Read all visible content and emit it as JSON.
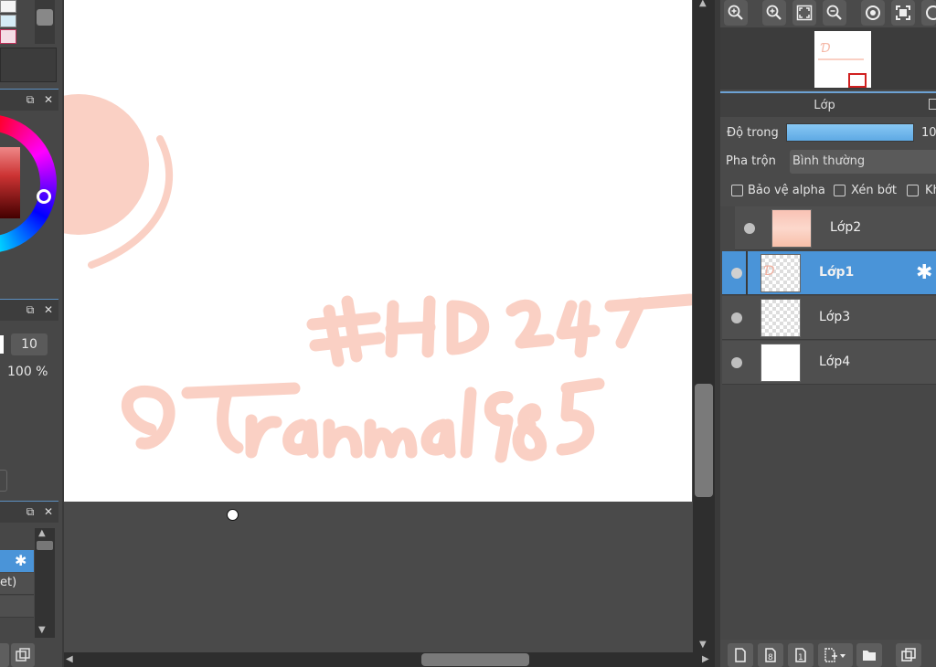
{
  "left_panel": {
    "brush_size_value": "10",
    "opacity_value": "100 %",
    "list_item_partial": "et)"
  },
  "layers_panel": {
    "tab_label": "Lớp",
    "opacity_label": "Độ trong",
    "opacity_value": "10",
    "blend_label": "Pha trộn",
    "blend_value": "Bình thường",
    "protect_alpha_label": "Bảo vệ alpha",
    "clipping_label": "Xén bớt",
    "lock_label_partial": "Kh",
    "layers": [
      {
        "name": "Lớp2",
        "selected": false
      },
      {
        "name": "Lớp1",
        "selected": true
      },
      {
        "name": "Lớp3",
        "selected": false
      },
      {
        "name": "Lớp4",
        "selected": false
      }
    ]
  },
  "colors": {
    "accent": "#4a94d8",
    "artwork_stroke": "#fad0c4"
  },
  "icons": {
    "toolbar": [
      "zoom-fit-icon",
      "zoom-in-icon",
      "fit-screen-icon",
      "zoom-out-icon",
      "rotate-icon",
      "fullscreen-icon",
      "reset-view-icon"
    ],
    "bottom": [
      "new-layer-icon",
      "new-8bit-layer-icon",
      "new-1bit-layer-icon",
      "add-special-layer-icon",
      "new-folder-icon",
      "duplicate-layer-icon"
    ]
  }
}
